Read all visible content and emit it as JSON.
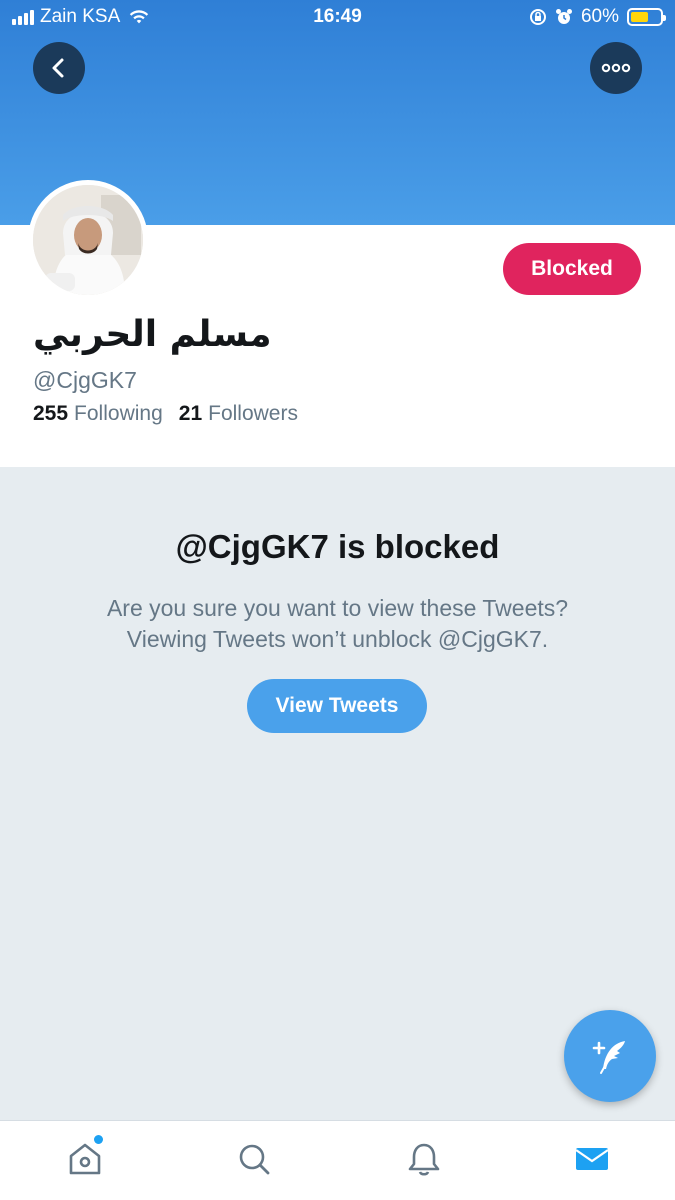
{
  "status_bar": {
    "carrier": "Zain KSA",
    "time": "16:49",
    "battery_percent": "60%",
    "battery_level": 0.6
  },
  "profile": {
    "display_name": "مسلم الحربي",
    "handle": "@CjgGK7",
    "following_count": "255",
    "following_label": "Following",
    "followers_count": "21",
    "followers_label": "Followers",
    "blocked_label": "Blocked"
  },
  "blocked_notice": {
    "title": "@CjgGK7 is blocked",
    "line1": "Are you sure you want to view these Tweets?",
    "line2": "Viewing Tweets won’t unblock @CjgGK7.",
    "button": "View Tweets"
  },
  "icons": {
    "back": "chevron-left-icon",
    "more": "more-icon",
    "compose": "compose-tweet-icon",
    "tabs": [
      "home-icon",
      "search-icon",
      "bell-icon",
      "mail-icon"
    ]
  },
  "colors": {
    "banner_top": "#2f7fd6",
    "banner_bottom": "#4a9ee8",
    "blocked_pill": "#e0245e",
    "accent": "#4aa1eb",
    "active_tab": "#1da1f2"
  }
}
